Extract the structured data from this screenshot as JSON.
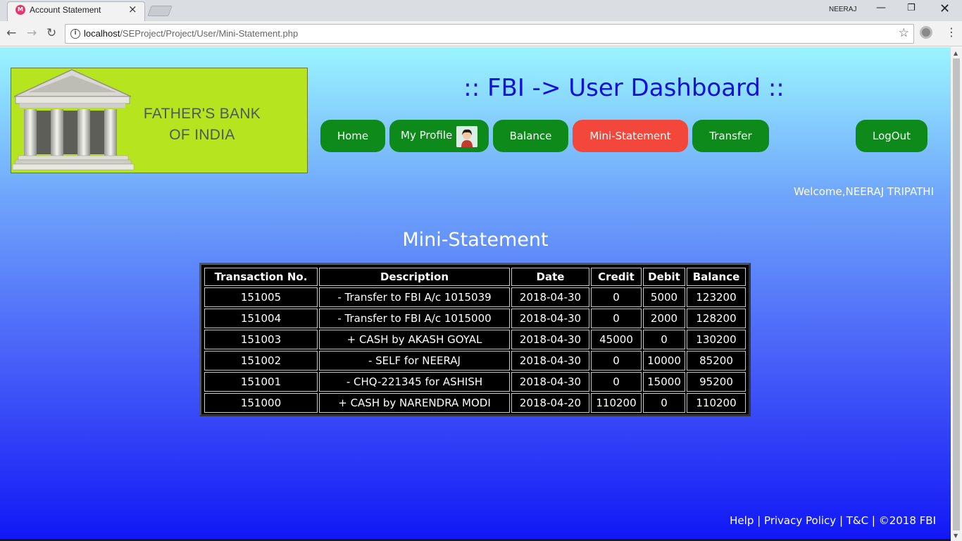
{
  "browser": {
    "tab_title": "Account Statement",
    "tab_close": "×",
    "profile_name": "NEERAJ",
    "url_host": "localhost",
    "url_path": "/SEProject/Project/User/Mini-Statement.php",
    "window_min": "—",
    "window_max": "❐",
    "window_close": "✕"
  },
  "header": {
    "logo_line1": "FATHER'S BANK",
    "logo_line2": "OF INDIA",
    "title": ":: FBI -> User Dashboard ::"
  },
  "nav": {
    "home": "Home",
    "profile": "My Profile",
    "balance": "Balance",
    "mini_statement": "Mini-Statement",
    "transfer": "Transfer",
    "logout": "LogOut"
  },
  "welcome_text": "Welcome,NEERAJ TRIPATHI",
  "section_title": "Mini-Statement",
  "statement": {
    "columns": [
      "Transaction No.",
      "Description",
      "Date",
      "Credit",
      "Debit",
      "Balance"
    ],
    "rows": [
      [
        "151005",
        "- Transfer to FBI A/c 1015039",
        "2018-04-30",
        "0",
        "5000",
        "123200"
      ],
      [
        "151004",
        "- Transfer to FBI A/c 1015000",
        "2018-04-30",
        "0",
        "2000",
        "128200"
      ],
      [
        "151003",
        "+ CASH by AKASH GOYAL",
        "2018-04-30",
        "45000",
        "0",
        "130200"
      ],
      [
        "151002",
        "- SELF for NEERAJ",
        "2018-04-30",
        "0",
        "10000",
        "85200"
      ],
      [
        "151001",
        "- CHQ-221345 for ASHISH",
        "2018-04-30",
        "0",
        "15000",
        "95200"
      ],
      [
        "151000",
        "+ CASH by NARENDRA MODI",
        "2018-04-20",
        "110200",
        "0",
        "110200"
      ]
    ]
  },
  "footer": {
    "help": "Help",
    "privacy": "Privacy Policy",
    "terms": "T&C",
    "copyright": "©2018 FBI",
    "separator": " | "
  },
  "colors": {
    "nav_green": "#0d8a1a",
    "nav_active_red": "#f4473c",
    "title_blue": "#1010d8",
    "logo_green": "#b6e520"
  }
}
